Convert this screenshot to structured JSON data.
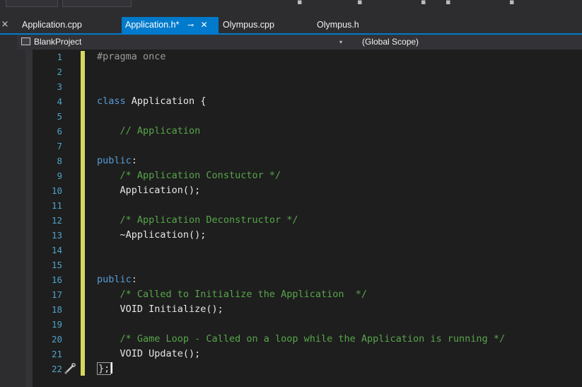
{
  "tabs": {
    "items": [
      {
        "label": "Application.cpp",
        "active": false
      },
      {
        "label": "Application.h*",
        "active": true,
        "pin_icon": "pin-icon",
        "close_icon": "close-icon"
      },
      {
        "label": "Olympus.cpp",
        "active": false
      },
      {
        "label": "Olympus.h",
        "active": false
      }
    ],
    "strip_close": "×",
    "pin_glyph": "⊸",
    "close_glyph": "✕"
  },
  "navbar": {
    "project": "BlankProject",
    "scope": "(Global Scope)",
    "dropdown_glyph": "▾"
  },
  "editor": {
    "accent_change_bar": "#d6d85e",
    "lines": [
      {
        "num": "1",
        "segments": [
          [
            "pre",
            "#pragma once"
          ]
        ]
      },
      {
        "num": "2",
        "segments": []
      },
      {
        "num": "3",
        "segments": []
      },
      {
        "num": "4",
        "segments": [
          [
            "kw",
            "class "
          ],
          [
            "cls",
            "Application {"
          ]
        ]
      },
      {
        "num": "5",
        "segments": []
      },
      {
        "num": "6",
        "segments": [
          [
            "plain",
            "    "
          ],
          [
            "com",
            "// Application"
          ]
        ]
      },
      {
        "num": "7",
        "segments": []
      },
      {
        "num": "8",
        "segments": [
          [
            "kw",
            "public"
          ],
          [
            "plain",
            ":"
          ]
        ]
      },
      {
        "num": "9",
        "segments": [
          [
            "plain",
            "    "
          ],
          [
            "com",
            "/* Application Constuctor */"
          ]
        ]
      },
      {
        "num": "10",
        "segments": [
          [
            "plain",
            "    "
          ],
          [
            "fn",
            "Application();"
          ]
        ]
      },
      {
        "num": "11",
        "segments": []
      },
      {
        "num": "12",
        "segments": [
          [
            "plain",
            "    "
          ],
          [
            "com",
            "/* Application Deconstructor */"
          ]
        ]
      },
      {
        "num": "13",
        "segments": [
          [
            "plain",
            "    "
          ],
          [
            "fn",
            "~Application();"
          ]
        ]
      },
      {
        "num": "14",
        "segments": []
      },
      {
        "num": "15",
        "segments": []
      },
      {
        "num": "16",
        "segments": [
          [
            "kw",
            "public"
          ],
          [
            "plain",
            ":"
          ]
        ]
      },
      {
        "num": "17",
        "segments": [
          [
            "plain",
            "    "
          ],
          [
            "com",
            "/* Called to Initialize the Application  */"
          ]
        ]
      },
      {
        "num": "18",
        "segments": [
          [
            "plain",
            "    "
          ],
          [
            "fn",
            "VOID Initialize();"
          ]
        ]
      },
      {
        "num": "19",
        "segments": []
      },
      {
        "num": "20",
        "segments": [
          [
            "plain",
            "    "
          ],
          [
            "com",
            "/* Game Loop - Called on a loop while the Application is running */"
          ]
        ]
      },
      {
        "num": "21",
        "segments": [
          [
            "plain",
            "    "
          ],
          [
            "fn",
            "VOID Update();"
          ]
        ]
      },
      {
        "num": "22",
        "segments": [
          [
            "box",
            "};"
          ]
        ],
        "caret": true,
        "quick_action_icon": "screwdriver-brush-icon"
      }
    ]
  }
}
